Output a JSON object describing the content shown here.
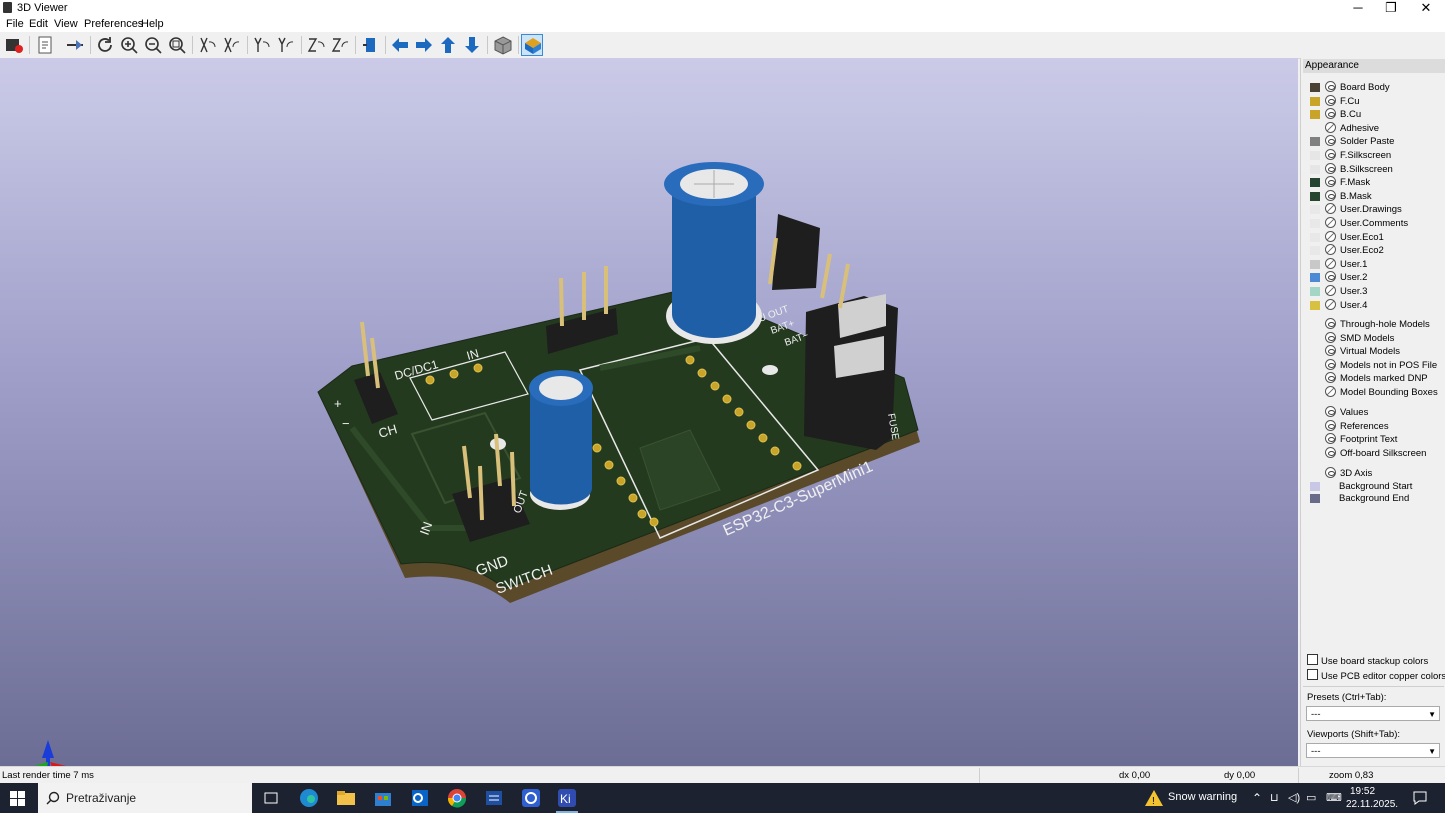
{
  "window": {
    "title": "3D Viewer",
    "minimize": "─",
    "maximize": "❐",
    "close": "✕"
  },
  "menu": [
    "File",
    "Edit",
    "View",
    "Preferences",
    "Help"
  ],
  "toolbar_icons": [
    "render-icon",
    "export-image-icon",
    "flip-board-icon",
    "reload-icon",
    "zoom-in-icon",
    "zoom-out-icon",
    "zoom-fit-icon",
    "rotate-x-cw-icon",
    "rotate-x-ccw-icon",
    "rotate-y-cw-icon",
    "rotate-y-ccw-icon",
    "rotate-z-cw-icon",
    "rotate-z-ccw-icon",
    "flip-icon",
    "pan-left-icon",
    "pan-right-icon",
    "pan-up-icon",
    "pan-down-icon",
    "ortho-icon",
    "raytrace-icon"
  ],
  "pcb_labels": {
    "board_name": "ESP32-C3-SuperMini1",
    "dcdc": "DC/DC1",
    "in_top": "IN",
    "plus": "+",
    "minus": "−",
    "ch": "CH",
    "in_left": "IN",
    "gnd": "GND",
    "switch": "SWITCH",
    "out": "OUT",
    "u_out": "U OUT",
    "bat_plus": "BAT+",
    "bat_minus": "BAT−",
    "fuse": "FUSE"
  },
  "appearance": {
    "title": "Appearance",
    "layers": [
      {
        "name": "Board Body",
        "color": "#4a4034",
        "visible": true
      },
      {
        "name": "F.Cu",
        "color": "#c8a428",
        "visible": true
      },
      {
        "name": "B.Cu",
        "color": "#c8a428",
        "visible": true
      },
      {
        "name": "Adhesive",
        "color": "#f0f0f0",
        "visible": false
      },
      {
        "name": "Solder Paste",
        "color": "#808080",
        "visible": true
      },
      {
        "name": "F.Silkscreen",
        "color": "#e6e6e6",
        "visible": true
      },
      {
        "name": "B.Silkscreen",
        "color": "#e6e6e6",
        "visible": true
      },
      {
        "name": "F.Mask",
        "color": "#254530",
        "visible": true
      },
      {
        "name": "B.Mask",
        "color": "#254530",
        "visible": true
      },
      {
        "name": "User.Drawings",
        "color": "#e8e8e8",
        "visible": false
      },
      {
        "name": "User.Comments",
        "color": "#e8e8e8",
        "visible": false
      },
      {
        "name": "User.Eco1",
        "color": "#e8e8e8",
        "visible": false
      },
      {
        "name": "User.Eco2",
        "color": "#e8e8e8",
        "visible": false
      },
      {
        "name": "User.1",
        "color": "#c8c8c8",
        "visible": false
      },
      {
        "name": "User.2",
        "color": "#4c8ad6",
        "visible": true
      },
      {
        "name": "User.3",
        "color": "#a4d6c8",
        "visible": false
      },
      {
        "name": "User.4",
        "color": "#d8c040",
        "visible": false
      }
    ],
    "models": [
      {
        "name": "Through-hole Models",
        "visible": true
      },
      {
        "name": "SMD Models",
        "visible": true
      },
      {
        "name": "Virtual Models",
        "visible": true
      },
      {
        "name": "Models not in POS File",
        "visible": true
      },
      {
        "name": "Models marked DNP",
        "visible": true
      },
      {
        "name": "Model Bounding Boxes",
        "visible": false
      }
    ],
    "text_items": [
      {
        "name": "Values",
        "visible": true
      },
      {
        "name": "References",
        "visible": true
      },
      {
        "name": "Footprint Text",
        "visible": true
      },
      {
        "name": "Off-board Silkscreen",
        "visible": true
      }
    ],
    "axis": {
      "name": "3D Axis",
      "visible": true
    },
    "bg_start": {
      "name": "Background Start",
      "color": "#c8c8e6"
    },
    "bg_end": {
      "name": "Background End",
      "color": "#6a6a8a"
    },
    "use_stackup": "Use board stackup colors",
    "use_pcb_copper": "Use PCB editor copper colors",
    "presets_label": "Presets (Ctrl+Tab):",
    "presets_value": "---",
    "viewports_label": "Viewports (Shift+Tab):",
    "viewports_value": "---"
  },
  "status": {
    "render": "Last render time 7 ms",
    "dx": "dx 0,00",
    "dy": "dy 0,00",
    "zoom": "zoom 0,83"
  },
  "taskbar": {
    "search": "Pretraživanje",
    "weather": "Snow warning",
    "time": "19:52",
    "date": "22.11.2025."
  }
}
